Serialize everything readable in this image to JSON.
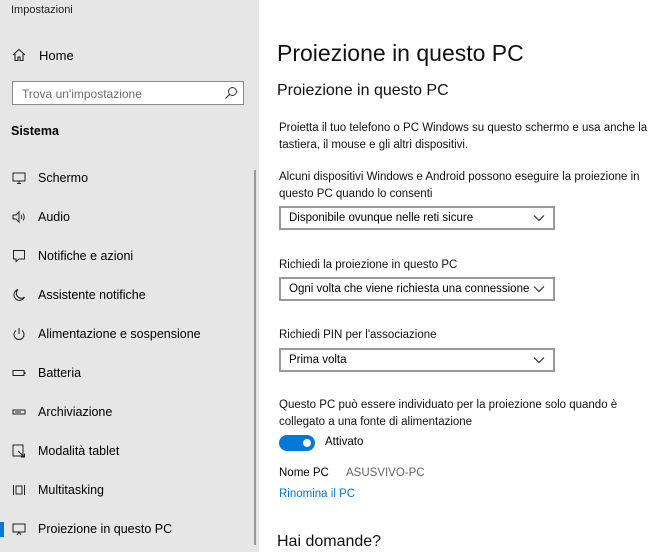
{
  "app": {
    "title": "Impostazioni"
  },
  "sidebar": {
    "home_label": "Home",
    "search_placeholder": "Trova un'impostazione",
    "section": "Sistema",
    "items": [
      {
        "label": "Schermo",
        "icon": "monitor-icon"
      },
      {
        "label": "Audio",
        "icon": "speaker-icon"
      },
      {
        "label": "Notifiche e azioni",
        "icon": "message-icon"
      },
      {
        "label": "Assistente notifiche",
        "icon": "moon-icon"
      },
      {
        "label": "Alimentazione e sospensione",
        "icon": "power-icon"
      },
      {
        "label": "Batteria",
        "icon": "battery-icon"
      },
      {
        "label": "Archiviazione",
        "icon": "storage-icon"
      },
      {
        "label": "Modalità tablet",
        "icon": "tablet-mode-icon"
      },
      {
        "label": "Multitasking",
        "icon": "multitasking-icon"
      },
      {
        "label": "Proiezione in questo PC",
        "icon": "projection-icon",
        "active": true
      }
    ]
  },
  "main": {
    "title": "Proiezione in questo PC",
    "subtitle": "Proiezione in questo PC",
    "intro": "Proietta il tuo telefono o PC Windows su questo schermo e usa anche la tastiera, il mouse e gli altri dispositivi.",
    "availability_label": "Alcuni dispositivi Windows e Android possono eseguire la proiezione in questo PC quando lo consenti",
    "availability_value": "Disponibile ovunque nelle reti sicure",
    "ask_label": "Richiedi la proiezione in questo PC",
    "ask_value": "Ogni volta che viene richiesta una connessione",
    "pin_label": "Richiedi PIN per l'associazione",
    "pin_value": "Prima volta",
    "power_label": "Questo PC può essere individuato per la proiezione solo quando è collegato a una fonte di alimentazione",
    "power_toggle_state": "Attivato",
    "pc_name_key": "Nome PC",
    "pc_name_value": "ASUSVIVO-PC",
    "rename_link": "Rinomina il PC",
    "faq_heading": "Hai domande?"
  },
  "colors": {
    "accent": "#0078d7",
    "sidebar_bg": "#e6e6e6"
  }
}
